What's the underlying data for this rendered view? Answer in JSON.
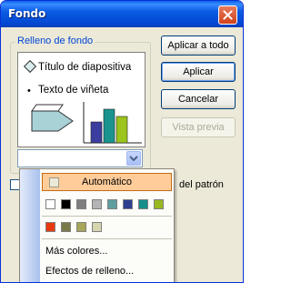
{
  "window": {
    "title": "Fondo"
  },
  "fill_group": {
    "label": "Relleno de fondo"
  },
  "preview": {
    "slide_title": "Título de diapositiva",
    "bullet": "•",
    "bullet_text": "Texto de viñeta"
  },
  "buttons": {
    "apply_all": "Aplicar a todo",
    "apply": "Aplicar",
    "cancel": "Cancelar",
    "preview": "Vista previa"
  },
  "checkbox": {
    "label": "del patrón"
  },
  "dropdown": {
    "automatic_label": "Automático",
    "automatic_color": "#ece9d8",
    "colors_row1": [
      "#ffffff",
      "#000000",
      "#7f7f7f",
      "#b4b4b4",
      "#5f9ea0",
      "#2f3e8f",
      "#168f8c",
      "#9ab820"
    ],
    "colors_row2": [
      "#e8380d",
      "#7a7a48",
      "#a7a65a",
      "#d6d5b0"
    ],
    "more_colors": "Más colores...",
    "fill_effects": "Efectos de relleno..."
  },
  "accent": "#0046d5"
}
